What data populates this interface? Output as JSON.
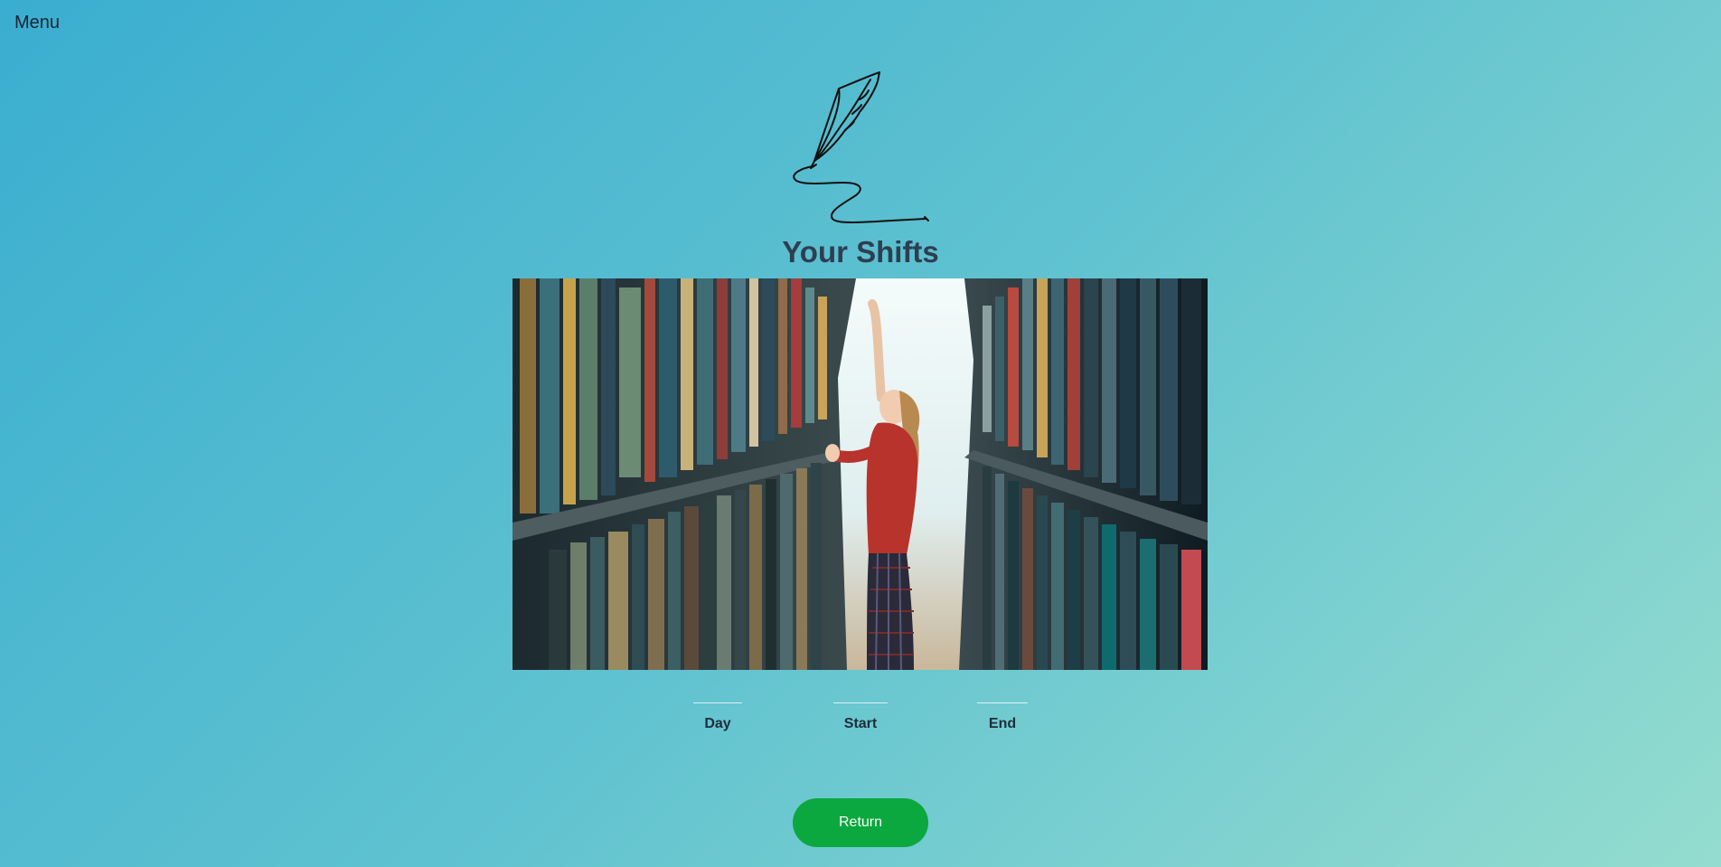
{
  "nav": {
    "menu_label": "Menu"
  },
  "header": {
    "title": "Your Shifts"
  },
  "logo": {
    "icon": "quill-pen-icon"
  },
  "photo": {
    "subject": "library-stacks-photo"
  },
  "table": {
    "columns": [
      "Day",
      "Start",
      "End"
    ]
  },
  "actions": {
    "return_label": "Return"
  },
  "colors": {
    "gradient_start": "#3aaed0",
    "gradient_end": "#94dccf",
    "button": "#0aa83e",
    "title": "#2e3e50"
  }
}
